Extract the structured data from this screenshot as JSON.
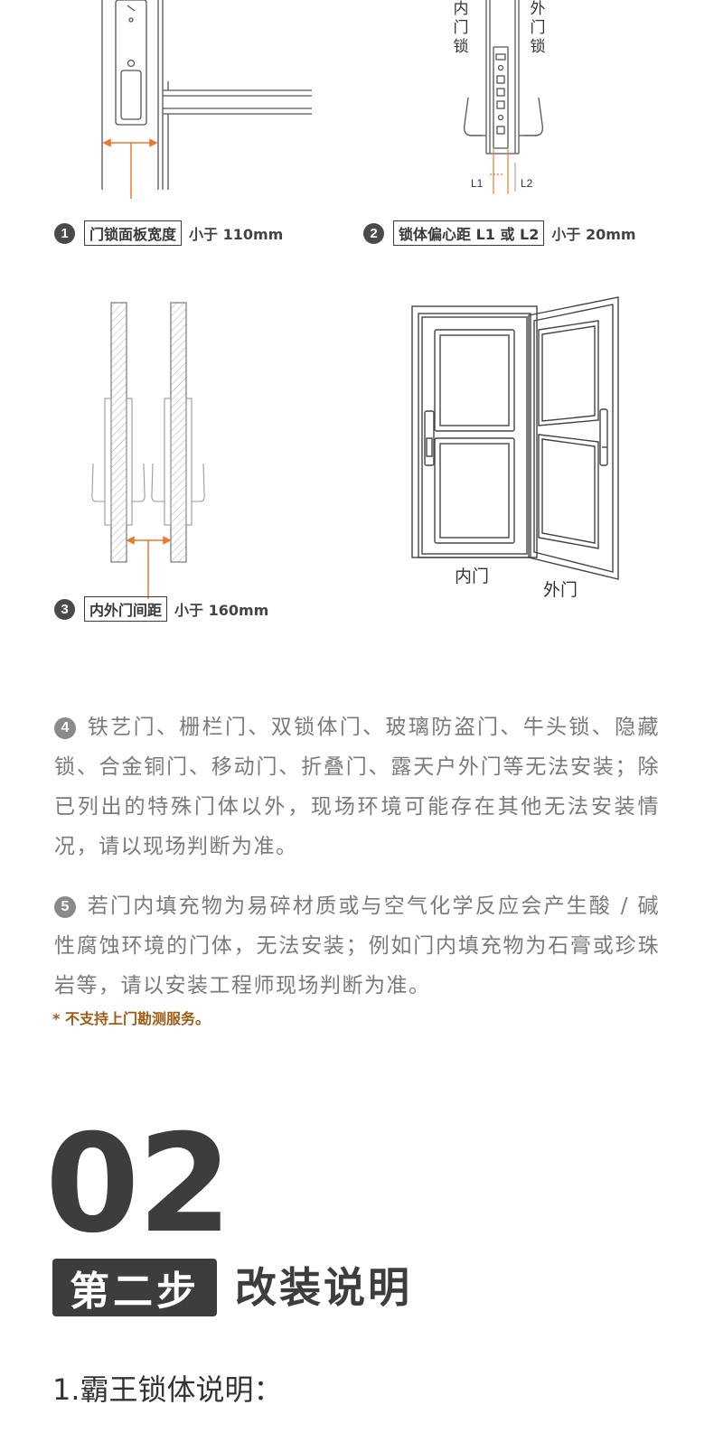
{
  "diagram1": {
    "number": "1",
    "label": "门锁面板宽度",
    "condition": "小于 110mm"
  },
  "diagram2": {
    "number": "2",
    "label": "锁体偏心距 L1 或 L2",
    "condition": "小于 20mm",
    "inner_lock": "内门锁",
    "outer_lock": "外门锁",
    "l1": "L1",
    "l2": "L2"
  },
  "diagram3": {
    "number": "3",
    "label": "内外门间距",
    "condition": "小于 160mm"
  },
  "diagram4": {
    "inner_door": "内门",
    "outer_door": "外门"
  },
  "paragraph4": {
    "number": "4",
    "text": "铁艺门、栅栏门、双锁体门、玻璃防盗门、牛头锁、隐藏锁、合金铜门、移动门、折叠门、露天户外门等无法安装；除已列出的特殊门体以外，现场环境可能存在其他无法安装情况，请以现场判断为准。"
  },
  "paragraph5": {
    "number": "5",
    "text": "若门内填充物为易碎材质或与空气化学反应会产生酸 / 碱性腐蚀环境的门体，无法安装；例如门内填充物为石膏或珍珠岩等，请以安装工程师现场判断为准。"
  },
  "note": "* 不支持上门勘测服务。",
  "section": {
    "number": "02",
    "step": "第二步",
    "title": "改装说明",
    "subheading": "1.霸王锁体说明："
  },
  "colors": {
    "accent_orange": "#e8792e",
    "note_brown": "#a05a14",
    "dark": "#3d3d3d",
    "body_gray": "#7a7a7a"
  }
}
